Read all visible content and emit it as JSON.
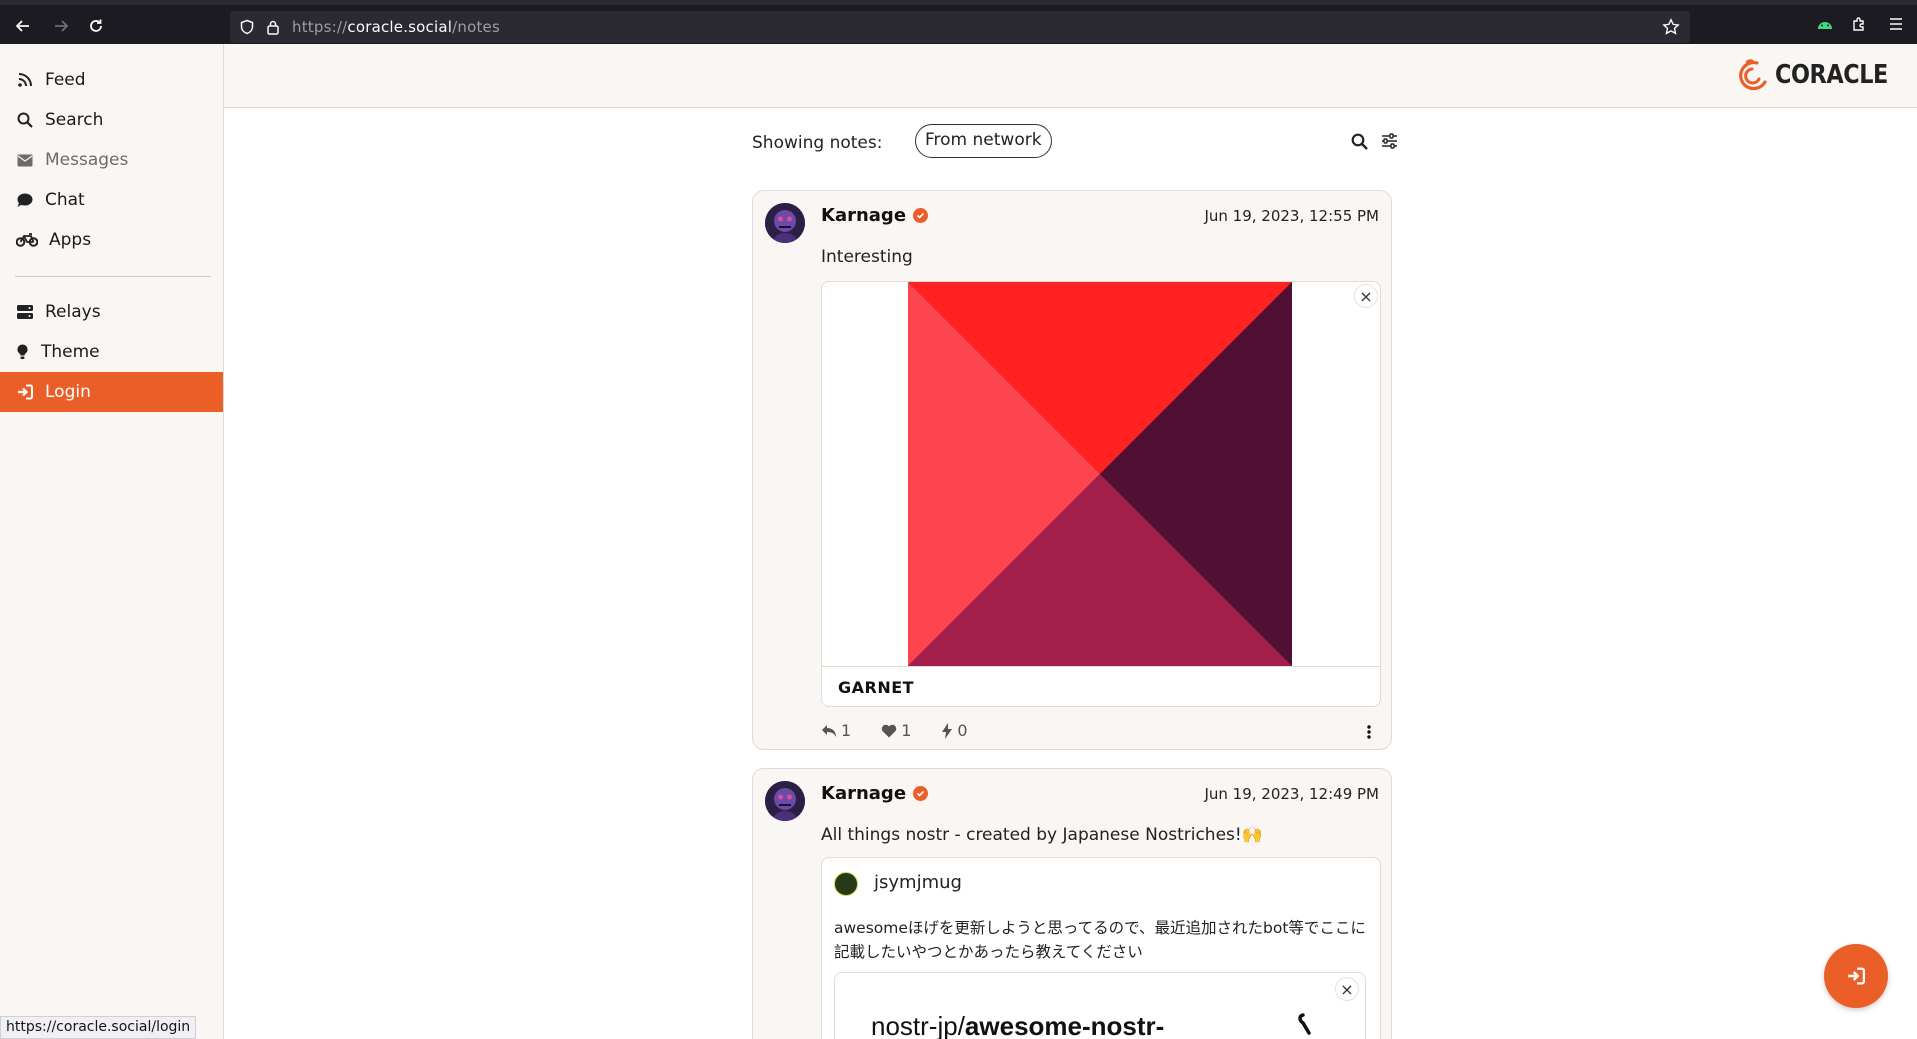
{
  "browser": {
    "url_scheme": "https://",
    "url_host": "coracle.social",
    "url_path": "/notes",
    "status_url": "https://coracle.social/login"
  },
  "sidebar": {
    "items": [
      {
        "label": "Feed",
        "icon": "rss-icon"
      },
      {
        "label": "Search",
        "icon": "search-icon"
      },
      {
        "label": "Messages",
        "icon": "envelope-icon"
      },
      {
        "label": "Chat",
        "icon": "comment-icon"
      },
      {
        "label": "Apps",
        "icon": "bicycle-icon"
      },
      {
        "label": "Relays",
        "icon": "server-icon"
      },
      {
        "label": "Theme",
        "icon": "lightbulb-icon"
      },
      {
        "label": "Login",
        "icon": "sign-in-icon"
      }
    ]
  },
  "brand": {
    "logo_text": "CORACLE",
    "accent": "#eb5e28"
  },
  "feed": {
    "showing_label": "Showing notes:",
    "filter_chip": "From network"
  },
  "notes": [
    {
      "author": "Karnage",
      "timestamp": "Jun 19, 2023, 12:55 PM",
      "content": "Interesting",
      "media_title": "GARNET",
      "replies": "1",
      "likes": "1",
      "zaps": "0"
    },
    {
      "author": "Karnage",
      "timestamp": "Jun 19, 2023, 12:49 PM",
      "content": "All things nostr - created by Japanese Nostriches!🙌",
      "quote": {
        "author": "jsymjmug",
        "text": "awesomeほげを更新しようと思ってるので、最近追加されたbot等でここに記載したいやつとかあったら教えてください",
        "link_prefix": "nostr-jp/",
        "link_bold": "awesome-nostr-"
      }
    }
  ]
}
